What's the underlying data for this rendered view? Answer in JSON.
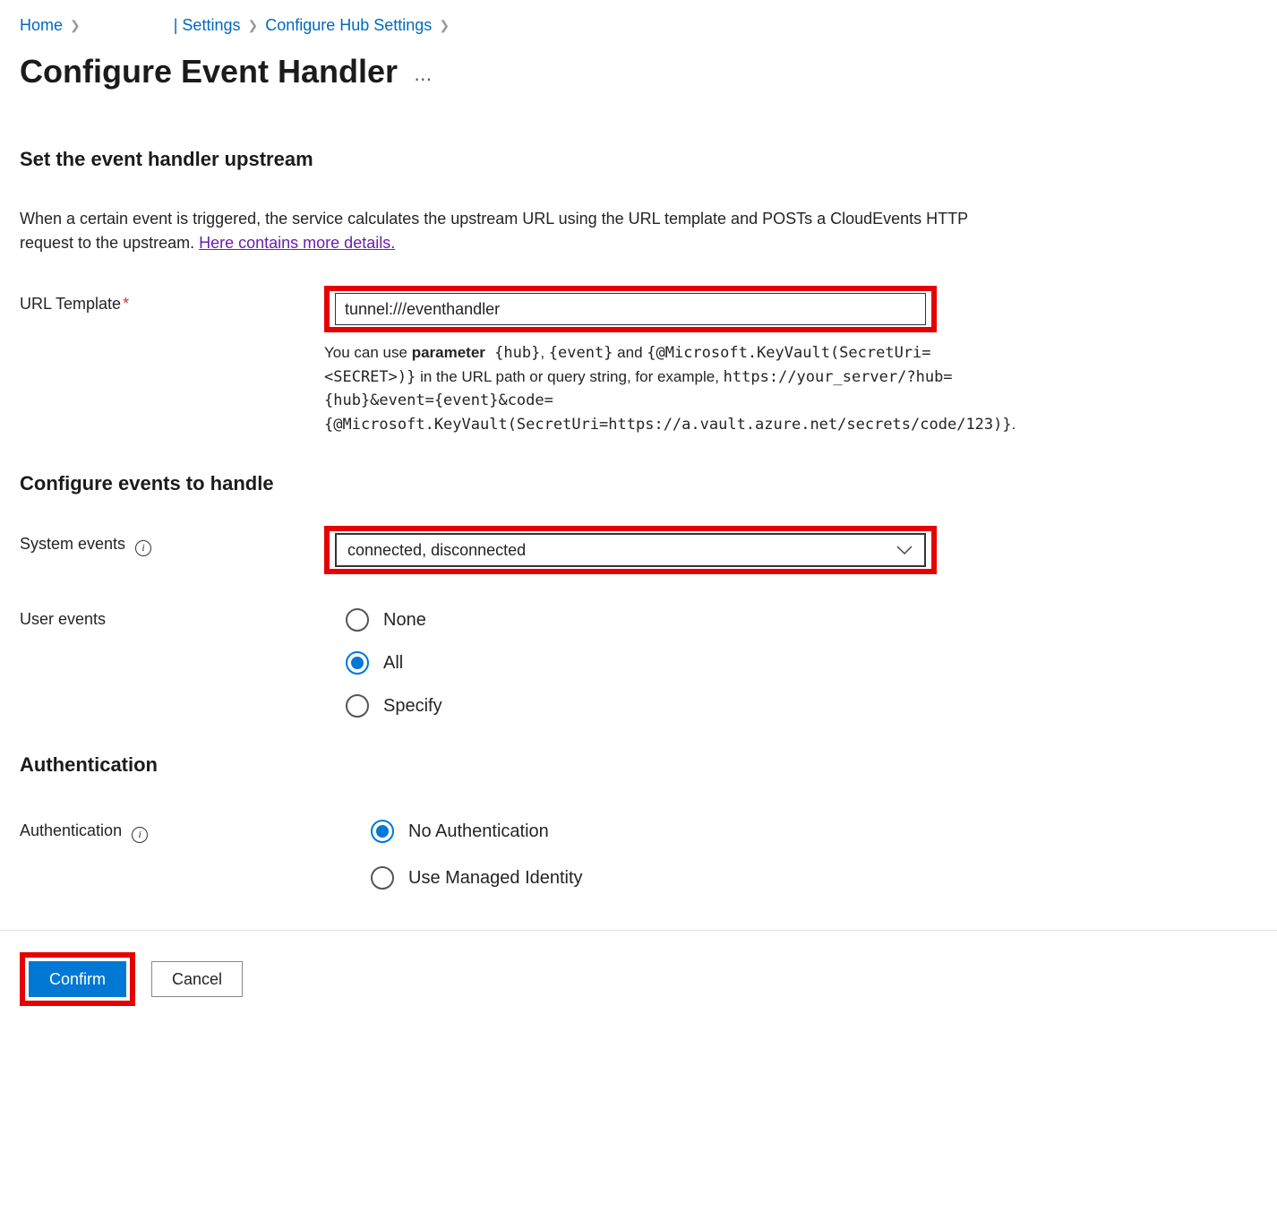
{
  "breadcrumb": {
    "home": "Home",
    "settings": "| Settings",
    "configure_hub": "Configure Hub Settings"
  },
  "title": "Configure Event Handler",
  "section1": {
    "heading": "Set the event handler upstream",
    "intro_pre": "When a certain event is triggered, the service calculates the upstream URL using the URL template and POSTs a CloudEvents HTTP request to the upstream. ",
    "intro_link": "Here contains more details."
  },
  "url_template": {
    "label": "URL Template",
    "value": "tunnel:///eventhandler",
    "help_pre": "You can use ",
    "help_bold": "parameter",
    "help_mono1": " {hub}",
    "help_mid1": ", ",
    "help_mono2": "{event}",
    "help_mid2": " and ",
    "help_mono3": "{@Microsoft.KeyVault(SecretUri=<SECRET>)}",
    "help_mid3": " in the URL path or query string, for example, ",
    "help_mono4": "https://your_server/?hub={hub}&event={event}&code={@Microsoft.KeyVault(SecretUri=https://a.vault.azure.net/secrets/code/123)}",
    "help_end": "."
  },
  "section2": {
    "heading": "Configure events to handle"
  },
  "system_events": {
    "label": "System events",
    "value": "connected, disconnected"
  },
  "user_events": {
    "label": "User events",
    "options": {
      "none": "None",
      "all": "All",
      "specify": "Specify"
    }
  },
  "section3": {
    "heading": "Authentication"
  },
  "auth": {
    "label": "Authentication",
    "options": {
      "none": "No Authentication",
      "managed": "Use Managed Identity"
    }
  },
  "footer": {
    "confirm": "Confirm",
    "cancel": "Cancel"
  }
}
